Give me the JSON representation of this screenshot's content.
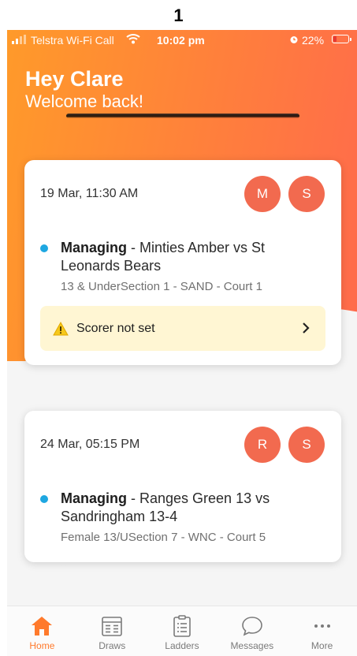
{
  "page_number": "1",
  "status_bar": {
    "carrier": "Telstra Wi-Fi Call",
    "time": "10:02 pm",
    "battery": "22%",
    "battery_level": 0.22
  },
  "greeting": {
    "title": "Hey Clare",
    "subtitle": "Welcome back!"
  },
  "matches": [
    {
      "date": "19 Mar, 11:30 AM",
      "roles": [
        "M",
        "S"
      ],
      "role_label": "Managing",
      "teams": "Minties Amber vs St Leonards Bears",
      "details": "13 & UnderSection 1 - SAND - Court 1",
      "alert": "Scorer not set"
    },
    {
      "date": "24 Mar, 05:15 PM",
      "roles": [
        "R",
        "S"
      ],
      "role_label": "Managing",
      "teams": "Ranges Green 13 vs Sandringham 13-4",
      "details": "Female 13/USection 7 - WNC - Court 5"
    }
  ],
  "tabs": [
    {
      "label": "Home",
      "icon": "home-icon",
      "active": true
    },
    {
      "label": "Draws",
      "icon": "calendar-icon"
    },
    {
      "label": "Ladders",
      "icon": "clipboard-icon"
    },
    {
      "label": "Messages",
      "icon": "chat-bubble-icon"
    },
    {
      "label": "More",
      "icon": "more-dots-icon"
    }
  ],
  "colors": {
    "gradient_start": "#ff9a2a",
    "gradient_end": "#ff6a4c",
    "avatar": "#f26a4f",
    "dot": "#1ea7e1",
    "alert_bg": "#fff6d3",
    "active_tab": "#ff7a2c"
  }
}
